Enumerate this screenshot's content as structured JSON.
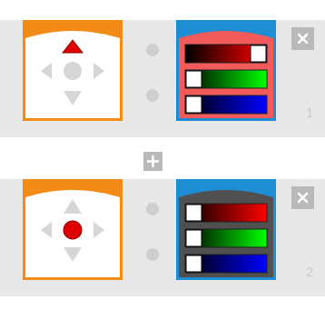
{
  "colors": {
    "row_bg": "#e8e8e8",
    "dpad_frame": "#f28c16",
    "color_frame": "#1d8ed1",
    "active_arrow": "#e00000",
    "inactive_arrow": "#d6d6d6"
  },
  "rules": [
    {
      "number": "1",
      "dpad": {
        "active_button": "up"
      },
      "color_panel": {
        "body_color": "#f35a5a",
        "sliders": [
          {
            "channel": "red",
            "level": 1.0
          },
          {
            "channel": "green",
            "level": 0.0
          },
          {
            "channel": "blue",
            "level": 0.0
          }
        ]
      }
    },
    {
      "number": "2",
      "dpad": {
        "active_button": "center"
      },
      "color_panel": {
        "body_color": "#505050",
        "sliders": [
          {
            "channel": "red",
            "level": 0.0
          },
          {
            "channel": "green",
            "level": 0.0
          },
          {
            "channel": "blue",
            "level": 0.0
          }
        ]
      }
    }
  ],
  "icons": {
    "remove": "close-icon",
    "add": "plus-icon"
  }
}
